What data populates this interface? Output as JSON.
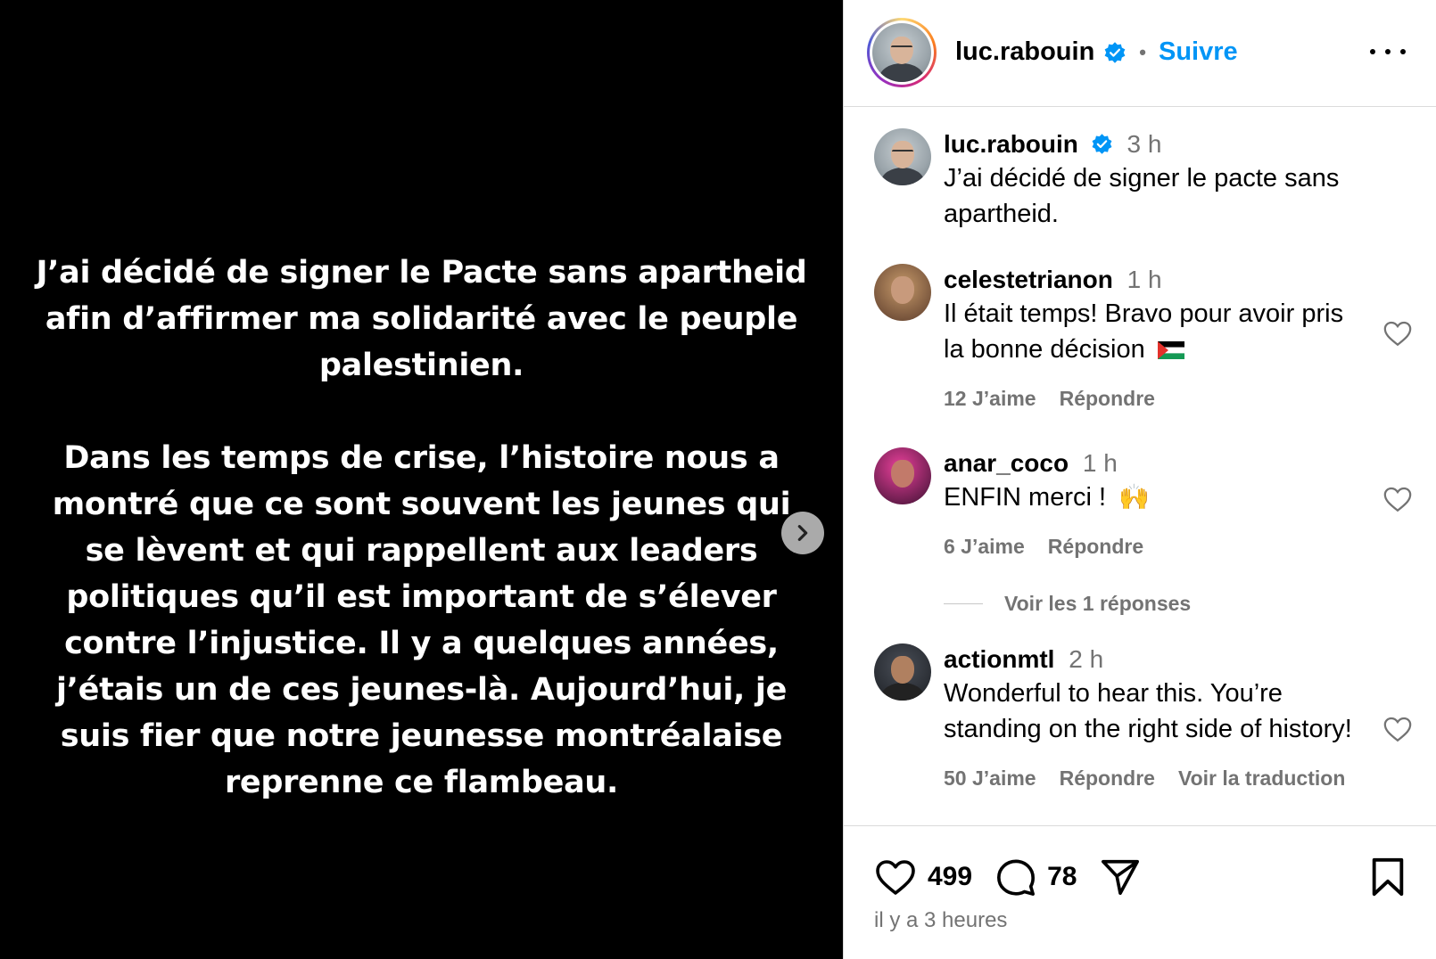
{
  "post": {
    "text_paragraph_1": "J’ai décidé de signer le Pacte sans apartheid afin d’affirmer ma solidarité avec le peuple palestinien.",
    "text_paragraph_2": "Dans les temps de crise, l’histoire nous a montré que ce sont souvent les jeunes qui se lèvent et qui rappellent aux leaders politiques qu’il est important de s’élever contre l’injustice. Il y a quelques années, j’étais un de ces jeunes-là. Aujourd’hui, je suis fier que notre jeunesse montréalaise reprenne ce flambeau."
  },
  "header": {
    "username": "luc.rabouin",
    "separator": "•",
    "follow_label": "Suivre"
  },
  "caption": {
    "username": "luc.rabouin",
    "time": "3 h",
    "text": "J’ai décidé de signer le pacte sans apartheid."
  },
  "comments": [
    {
      "username": "celestetrianon",
      "time": "1 h",
      "text": "Il était temps! Bravo pour avoir pris la bonne décision",
      "emoji": "palestine-flag",
      "likes": "12 J’aime",
      "reply": "Répondre"
    },
    {
      "username": "anar_coco",
      "time": "1 h",
      "text": "ENFIN merci !",
      "emoji": "🙌",
      "likes": "6 J’aime",
      "reply": "Répondre",
      "replies_toggle": "Voir les 1 réponses"
    },
    {
      "username": "actionmtl",
      "time": "2 h",
      "text": "Wonderful to hear this. You’re standing on the right side of history!",
      "likes": "50 J’aime",
      "reply": "Répondre",
      "translate": "Voir la traduction"
    }
  ],
  "actions": {
    "likes_count": "499",
    "comments_count": "78",
    "posted_ago": "il y a 3 heures"
  },
  "colors": {
    "accent": "#0095f6",
    "secondary_text": "#737373",
    "border": "#dbdbdb",
    "media_bg": "#000000"
  }
}
